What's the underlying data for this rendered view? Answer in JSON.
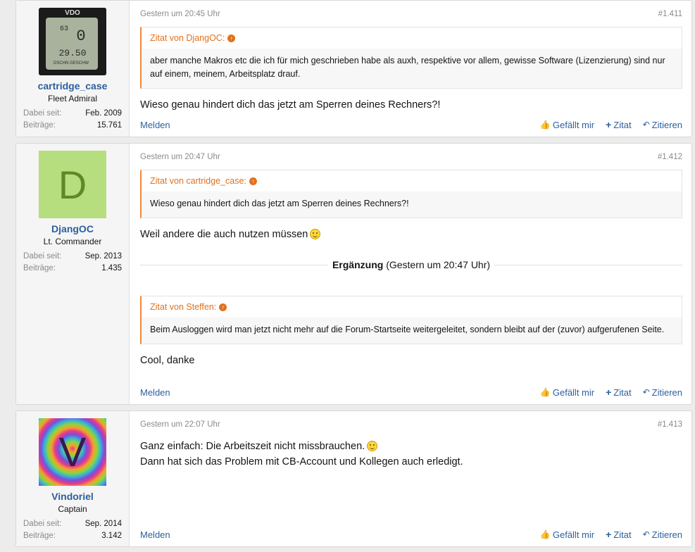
{
  "posts": [
    {
      "user": {
        "name": "cartridge_case",
        "title": "Fleet Admiral",
        "joined_label": "Dabei seit:",
        "joined": "Feb. 2009",
        "posts_label": "Beiträge:",
        "posts": "15.761",
        "avatar": {
          "brand": "VDO",
          "line1": "63",
          "line2": "0",
          "line3": "29.50",
          "line4": "DSCHN GESCHW"
        }
      },
      "time": "Gestern um 20:45 Uhr",
      "number": "#1.411",
      "quote_head": "Zitat von DjangOC:",
      "quote_body": "aber manche Makros etc die ich für mich geschrieben habe als auxh, respektive vor allem, gewisse Software (Lizenzierung) sind nur auf einem, meinem, Arbeitsplatz drauf.",
      "text": "Wieso genau hindert dich das jetzt am Sperren deines Rechners?!"
    },
    {
      "user": {
        "name": "DjangOC",
        "title": "Lt. Commander",
        "joined_label": "Dabei seit:",
        "joined": "Sep. 2013",
        "posts_label": "Beiträge:",
        "posts": "1.435",
        "avatar_letter": "D"
      },
      "time": "Gestern um 20:47 Uhr",
      "number": "#1.412",
      "quote_head": "Zitat von cartridge_case:",
      "quote_body": "Wieso genau hindert dich das jetzt am Sperren deines Rechners?!",
      "text": "Weil andere die auch nutzen müssen",
      "addition_label": "Ergänzung",
      "addition_time": "(Gestern um 20:47 Uhr)",
      "quote2_head": "Zitat von Steffen:",
      "quote2_body": "Beim Ausloggen wird man jetzt nicht mehr auf die Forum-Startseite weitergeleitet, sondern bleibt auf der (zuvor) aufgerufenen Seite.",
      "text2": "Cool, danke"
    },
    {
      "user": {
        "name": "Vindoriel",
        "title": "Captain",
        "joined_label": "Dabei seit:",
        "joined": "Sep. 2014",
        "posts_label": "Beiträge:",
        "posts": "3.142",
        "avatar_letter": "V"
      },
      "time": "Gestern um 22:07 Uhr",
      "number": "#1.413",
      "text_line1": "Ganz einfach: Die Arbeitszeit nicht missbrauchen.",
      "text_line2": "Dann hat sich das Problem mit CB-Account und Kollegen auch erledigt."
    }
  ],
  "actions": {
    "report": "Melden",
    "like": "Gefällt mir",
    "quote": "Zitat",
    "reply": "Zitieren"
  },
  "colors": {
    "link": "#2c5f9e",
    "quote_accent": "#e2711d",
    "avatar_d": "#b7de7e"
  }
}
